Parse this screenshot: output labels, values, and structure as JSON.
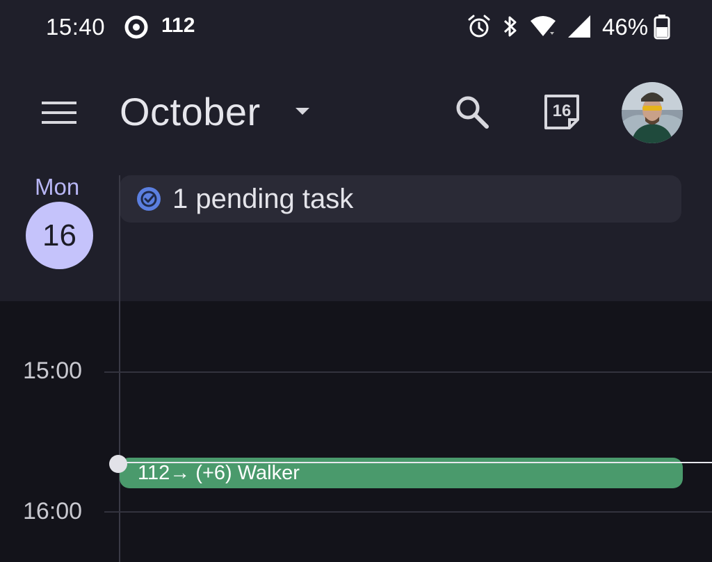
{
  "status_bar": {
    "time": "15:40",
    "notification_count": "112",
    "battery_percent": "46%",
    "icons": [
      "ring-app-icon",
      "alarm-icon",
      "bluetooth-icon",
      "wifi-icon",
      "signal-icon",
      "battery-icon"
    ]
  },
  "app_bar": {
    "month": "October",
    "today_date": "16",
    "icons": [
      "menu-icon",
      "dropdown-caret-icon",
      "search-icon",
      "today-calendar-icon",
      "avatar"
    ]
  },
  "day": {
    "name": "Mon",
    "number": "16"
  },
  "tasks": {
    "label": "1 pending task"
  },
  "timeline": {
    "hours": [
      "15:00",
      "16:00"
    ]
  },
  "events": [
    {
      "title": "112→ (+6) Walker",
      "color": "#4a9a6c"
    }
  ],
  "colors": {
    "background": "#13131a",
    "header_background": "#1f1f2a",
    "accent": "#c5c3fb",
    "event_green": "#4a9a6c",
    "task_check_blue": "#5b7fe0"
  }
}
